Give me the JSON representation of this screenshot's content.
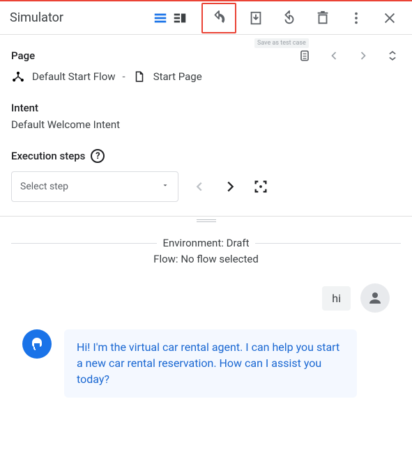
{
  "header": {
    "title": "Simulator",
    "tooltip": "Save as test case"
  },
  "page": {
    "section_label": "Page",
    "flow_name": "Default Start Flow",
    "separator": "-",
    "page_name": "Start Page"
  },
  "intent": {
    "section_label": "Intent",
    "value": "Default Welcome Intent"
  },
  "execution": {
    "section_label": "Execution steps",
    "select_placeholder": "Select step"
  },
  "context": {
    "environment_label": "Environment:",
    "environment_value": "Draft",
    "flow_label": "Flow:",
    "flow_value": "No flow selected"
  },
  "chat": {
    "user_message": "hi",
    "bot_message": "Hi! I'm the virtual car rental agent. I can help you start a new car rental reservation. How can I assist you today?"
  }
}
